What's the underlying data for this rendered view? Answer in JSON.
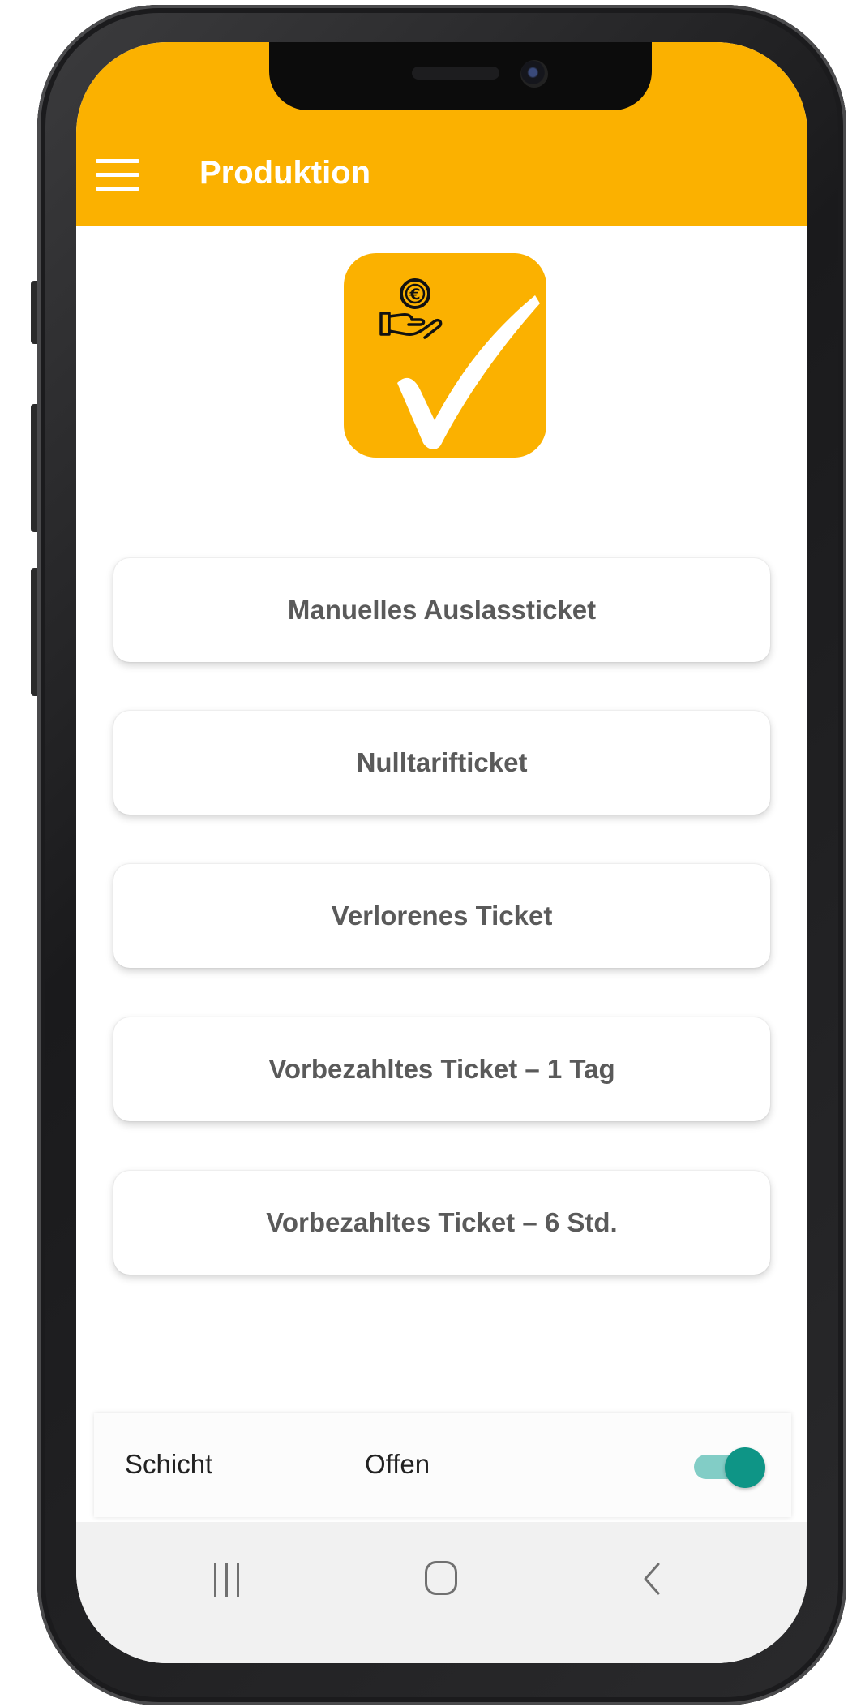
{
  "appbar": {
    "title": "Produktion",
    "color": "#fbb100",
    "menu_icon": "hamburger-menu-icon"
  },
  "logo": {
    "icon": "euro-coin-hand-checkmark-icon"
  },
  "actions": [
    {
      "label": "Manuelles Auslassticket"
    },
    {
      "label": "Nulltarifticket"
    },
    {
      "label": "Verlorenes Ticket"
    },
    {
      "label": "Vorbezahltes Ticket – 1 Tag"
    },
    {
      "label": "Vorbezahltes Ticket – 6 Std."
    }
  ],
  "shift": {
    "label": "Schicht",
    "value": "Offen",
    "toggle_on": true,
    "toggle_color": "#0e9586"
  },
  "navbar": {
    "recent_icon": "recent-apps-icon",
    "home_icon": "home-icon",
    "back_icon": "back-icon"
  }
}
